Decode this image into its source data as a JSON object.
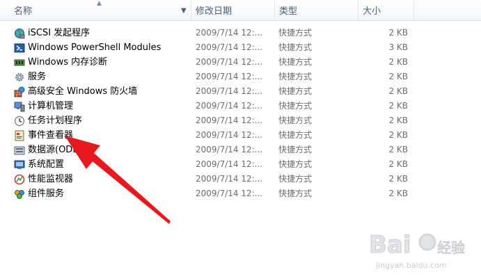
{
  "header": {
    "col_name": "名称",
    "col_date": "修改日期",
    "col_type": "类型",
    "col_size": "大小"
  },
  "rows": [
    {
      "name": "iSCSI 发起程序",
      "date": "2009/7/14 12:...",
      "type": "快捷方式",
      "size": "2 KB",
      "icon": "iscsi-globe-icon"
    },
    {
      "name": "Windows PowerShell Modules",
      "date": "2009/7/14 12:...",
      "type": "快捷方式",
      "size": "3 KB",
      "icon": "powershell-icon"
    },
    {
      "name": "Windows 内存诊断",
      "date": "2009/7/14 12:...",
      "type": "快捷方式",
      "size": "2 KB",
      "icon": "memory-diagnostic-icon"
    },
    {
      "name": "服务",
      "date": "2009/7/14 12:...",
      "type": "快捷方式",
      "size": "2 KB",
      "icon": "services-gear-icon"
    },
    {
      "name": "高级安全 Windows 防火墙",
      "date": "2009/7/14 12:...",
      "type": "快捷方式",
      "size": "2 KB",
      "icon": "firewall-icon"
    },
    {
      "name": "计算机管理",
      "date": "2009/7/14 12:...",
      "type": "快捷方式",
      "size": "2 KB",
      "icon": "computer-management-icon"
    },
    {
      "name": "任务计划程序",
      "date": "2009/7/14 12:...",
      "type": "快捷方式",
      "size": "2 KB",
      "icon": "task-scheduler-clock-icon"
    },
    {
      "name": "事件查看器",
      "date": "2009/7/14 12:...",
      "type": "快捷方式",
      "size": "2 KB",
      "icon": "event-viewer-icon"
    },
    {
      "name": "数据源(ODBC)",
      "date": "2009/7/14 12:...",
      "type": "快捷方式",
      "size": "2 KB",
      "icon": "odbc-data-source-icon"
    },
    {
      "name": "系统配置",
      "date": "2009/7/14 12:...",
      "type": "快捷方式",
      "size": "2 KB",
      "icon": "system-configuration-icon"
    },
    {
      "name": "性能监视器",
      "date": "2009/7/14 12:...",
      "type": "快捷方式",
      "size": "2 KB",
      "icon": "performance-monitor-icon"
    },
    {
      "name": "组件服务",
      "date": "2009/7/14 12:...",
      "type": "快捷方式",
      "size": "2 KB",
      "icon": "component-services-icon"
    }
  ],
  "watermark": {
    "url": "jingyan.baidu.com"
  },
  "colors": {
    "header_text": "#4c607a",
    "arrow": "#e8191e"
  }
}
